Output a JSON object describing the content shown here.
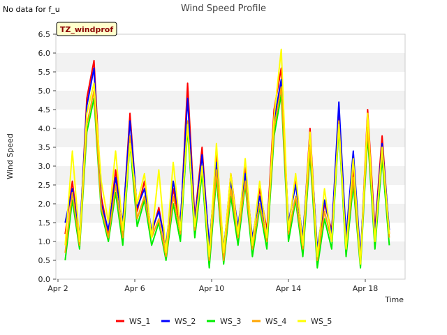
{
  "page": {
    "note": "No data for f_u"
  },
  "chart_data": {
    "type": "line",
    "title": "Wind Speed Profile",
    "site_label": "TZ_windprof",
    "xlabel": "Time",
    "ylabel": "Wind Speed",
    "ylim": [
      0.0,
      6.5
    ],
    "yticks": [
      "0.0",
      "0.5",
      "1.0",
      "1.5",
      "2.0",
      "2.5",
      "3.0",
      "3.5",
      "4.0",
      "4.5",
      "5.0",
      "5.5",
      "6.0",
      "6.5"
    ],
    "xlim": [
      "2018-04-02",
      "2018-04-20"
    ],
    "xticks": [
      {
        "date": "2018-04-02",
        "label": "Apr 2"
      },
      {
        "date": "2018-04-06",
        "label": "Apr 6"
      },
      {
        "date": "2018-04-10",
        "label": "Apr 10"
      },
      {
        "date": "2018-04-14",
        "label": "Apr 14"
      },
      {
        "date": "2018-04-18",
        "label": "Apr 18"
      }
    ],
    "grid": "horizontal bands",
    "legend_position": "bottom",
    "x": [
      "2018-04-02 09:00",
      "2018-04-02 18:00",
      "2018-04-03 03:00",
      "2018-04-03 12:00",
      "2018-04-03 21:00",
      "2018-04-04 06:00",
      "2018-04-04 15:00",
      "2018-04-05 00:00",
      "2018-04-05 09:00",
      "2018-04-05 18:00",
      "2018-04-06 03:00",
      "2018-04-06 12:00",
      "2018-04-06 21:00",
      "2018-04-07 06:00",
      "2018-04-07 15:00",
      "2018-04-08 00:00",
      "2018-04-08 09:00",
      "2018-04-08 18:00",
      "2018-04-09 03:00",
      "2018-04-09 12:00",
      "2018-04-09 21:00",
      "2018-04-10 06:00",
      "2018-04-10 15:00",
      "2018-04-11 00:00",
      "2018-04-11 09:00",
      "2018-04-11 18:00",
      "2018-04-12 03:00",
      "2018-04-12 12:00",
      "2018-04-12 21:00",
      "2018-04-13 06:00",
      "2018-04-13 15:00",
      "2018-04-14 00:00",
      "2018-04-14 09:00",
      "2018-04-14 18:00",
      "2018-04-15 03:00",
      "2018-04-15 12:00",
      "2018-04-15 21:00",
      "2018-04-16 06:00",
      "2018-04-16 15:00",
      "2018-04-17 00:00",
      "2018-04-17 09:00",
      "2018-04-17 18:00",
      "2018-04-18 03:00",
      "2018-04-18 12:00",
      "2018-04-18 21:00",
      "2018-04-19 06:00"
    ],
    "series": [
      {
        "name": "WS_1",
        "color": "#ff0000",
        "values": [
          1.2,
          2.6,
          1.0,
          4.8,
          5.8,
          2.2,
          1.2,
          2.9,
          1.4,
          4.4,
          1.8,
          2.6,
          1.2,
          1.9,
          0.8,
          2.4,
          1.4,
          5.2,
          1.6,
          3.5,
          0.8,
          3.3,
          0.7,
          2.8,
          1.3,
          3.0,
          1.0,
          2.4,
          1.3,
          4.5,
          5.6,
          1.4,
          2.6,
          1.0,
          4.0,
          0.7,
          2.0,
          1.3,
          4.4,
          1.0,
          2.9,
          0.5,
          4.5,
          1.3,
          3.8,
          1.2
        ]
      },
      {
        "name": "WS_2",
        "color": "#0000ff",
        "values": [
          1.5,
          2.4,
          1.1,
          4.6,
          5.6,
          2.0,
          1.3,
          2.7,
          1.5,
          4.2,
          1.9,
          2.4,
          1.3,
          1.8,
          0.9,
          2.6,
          1.5,
          4.8,
          1.5,
          3.3,
          0.9,
          3.1,
          0.8,
          2.6,
          1.4,
          2.8,
          1.1,
          2.2,
          1.2,
          4.2,
          5.3,
          1.5,
          2.5,
          1.1,
          3.8,
          0.8,
          2.1,
          1.2,
          4.7,
          1.1,
          3.4,
          0.6,
          4.2,
          1.2,
          3.6,
          1.3
        ]
      },
      {
        "name": "WS_3",
        "color": "#00ee00",
        "values": [
          0.5,
          2.1,
          0.8,
          3.9,
          4.8,
          1.8,
          1.0,
          2.3,
          0.9,
          3.6,
          1.4,
          2.1,
          0.9,
          1.5,
          0.5,
          2.0,
          1.0,
          4.0,
          1.1,
          2.8,
          0.3,
          2.7,
          0.4,
          2.2,
          0.9,
          2.5,
          0.6,
          1.9,
          0.8,
          3.8,
          4.9,
          1.0,
          2.1,
          0.6,
          3.3,
          0.3,
          1.6,
          0.8,
          4.0,
          0.6,
          2.5,
          0.3,
          3.8,
          0.8,
          3.2,
          0.9
        ]
      },
      {
        "name": "WS_4",
        "color": "#ffa500",
        "values": [
          0.7,
          2.3,
          0.9,
          4.1,
          5.0,
          1.9,
          1.1,
          2.5,
          1.1,
          3.8,
          1.6,
          2.2,
          1.1,
          1.6,
          0.6,
          2.2,
          1.2,
          4.2,
          1.3,
          3.0,
          0.5,
          2.9,
          0.5,
          2.4,
          1.1,
          2.6,
          0.8,
          2.0,
          1.0,
          4.0,
          5.1,
          1.2,
          2.2,
          0.8,
          3.5,
          0.5,
          1.8,
          1.0,
          4.2,
          0.8,
          2.7,
          0.4,
          4.0,
          1.0,
          3.4,
          1.1
        ]
      },
      {
        "name": "WS_5",
        "color": "#ffff00",
        "values": [
          0.9,
          3.4,
          1.0,
          4.4,
          5.2,
          2.6,
          1.5,
          3.4,
          1.3,
          3.6,
          2.0,
          2.8,
          1.1,
          2.9,
          0.7,
          3.1,
          1.3,
          4.1,
          1.4,
          3.0,
          0.6,
          3.6,
          0.7,
          2.8,
          1.2,
          3.2,
          0.9,
          2.6,
          1.1,
          4.3,
          6.1,
          1.3,
          2.8,
          0.9,
          3.9,
          0.6,
          2.4,
          1.0,
          4.1,
          0.8,
          3.2,
          0.4,
          4.4,
          1.0,
          3.5,
          1.2
        ]
      }
    ]
  }
}
